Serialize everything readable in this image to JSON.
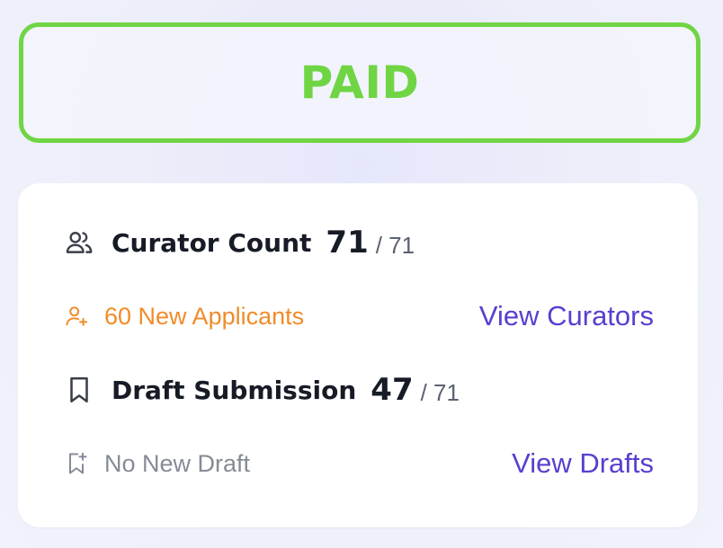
{
  "status": {
    "label": "PAID",
    "color": "#6fd544"
  },
  "curators": {
    "icon": "users-icon",
    "title": "Curator Count",
    "count": "71",
    "total": "/ 71",
    "applicants_icon": "user-plus-icon",
    "applicants_text": "60 New Applicants",
    "applicants_color": "#f08c2a",
    "link": "View Curators"
  },
  "drafts": {
    "icon": "bookmark-icon",
    "title": "Draft Submission",
    "count": "47",
    "total": "/ 71",
    "status_icon": "bookmark-plus-icon",
    "status_text": "No New Draft",
    "link": "View Drafts"
  },
  "colors": {
    "link": "#5a3fcf",
    "text": "#161b26",
    "muted": "#858b96"
  }
}
